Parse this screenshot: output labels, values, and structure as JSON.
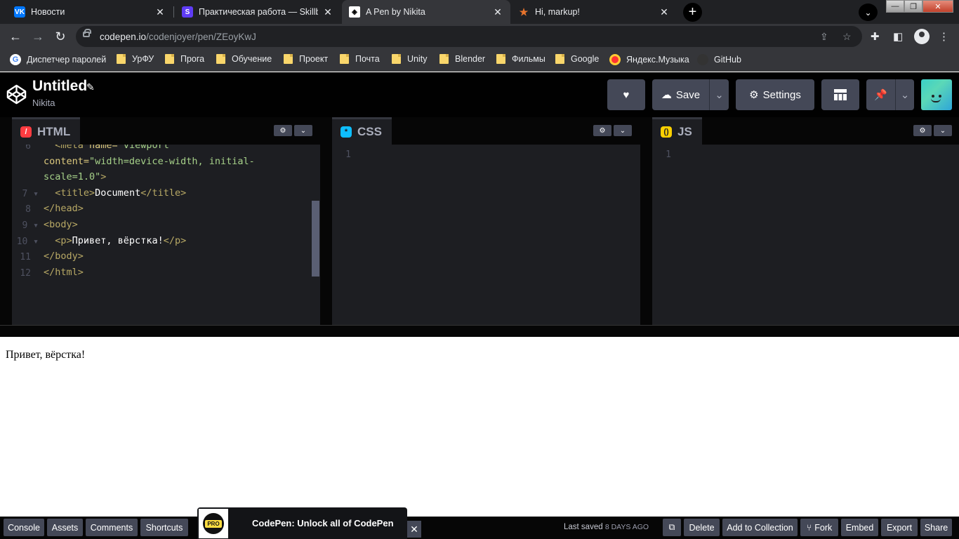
{
  "browser": {
    "tabs": [
      {
        "title": "Новости",
        "favicon": "vk-icon",
        "color": "#0077ff",
        "glyph": "VK"
      },
      {
        "title": "Практическая работа — Skillbox",
        "favicon": "skillbox-icon",
        "color": "#5f3cf5",
        "glyph": "S"
      },
      {
        "title": "A Pen by Nikita",
        "favicon": "codepen-icon",
        "color": "#ffffff",
        "glyph": "◈"
      },
      {
        "title": "Hi, markup!",
        "favicon": "star-icon",
        "color": "#202124",
        "glyph": "★"
      }
    ],
    "active_tab_index": 2,
    "url_host": "codepen.io",
    "url_path": "/codenjoyer/pen/ZEoyKwJ",
    "bookmarks": [
      {
        "label": "Диспетчер паролей",
        "icon": "google-icon"
      },
      {
        "label": "УрФУ",
        "icon": "folder-icon"
      },
      {
        "label": "Прога",
        "icon": "folder-icon"
      },
      {
        "label": "Обучение",
        "icon": "folder-icon"
      },
      {
        "label": "Проект",
        "icon": "folder-icon"
      },
      {
        "label": "Почта",
        "icon": "folder-icon"
      },
      {
        "label": "Unity",
        "icon": "folder-icon"
      },
      {
        "label": "Blender",
        "icon": "folder-icon"
      },
      {
        "label": "Фильмы",
        "icon": "folder-icon"
      },
      {
        "label": "Google",
        "icon": "folder-icon"
      },
      {
        "label": "Яндекс.Музыка",
        "icon": "yandex-music-icon"
      },
      {
        "label": "GitHub",
        "icon": "github-icon"
      }
    ]
  },
  "header": {
    "title": "Untitled",
    "author": "Nikita",
    "save_label": "Save",
    "settings_label": "Settings"
  },
  "editors": {
    "html": {
      "label": "HTML",
      "color": "#ff3c41",
      "glyph": "/",
      "lines": [
        {
          "num": "6",
          "html": "  <span class='tag'>&lt;meta</span> <span class='attr'>name=</span><span class='str'>\"viewport\"</span>",
          "fold": false
        },
        {
          "num": "",
          "html": "<span class='attr'>content=</span><span class='str'>\"width=device-width, initial-</span>",
          "fold": false
        },
        {
          "num": "",
          "html": "<span class='str'>scale=1.0\"</span><span class='tag'>&gt;</span>",
          "fold": false
        },
        {
          "num": "7",
          "html": "  <span class='tag'>&lt;title&gt;</span>Document<span class='tag'>&lt;/title&gt;</span>",
          "fold": true
        },
        {
          "num": "8",
          "html": "<span class='tag'>&lt;/head&gt;</span>",
          "fold": false
        },
        {
          "num": "9",
          "html": "<span class='tag'>&lt;body&gt;</span>",
          "fold": true
        },
        {
          "num": "10",
          "html": "  <span class='tag'>&lt;p&gt;</span>Привет, вёрстка!<span class='tag'>&lt;/p&gt;</span>",
          "fold": true
        },
        {
          "num": "11",
          "html": "<span class='tag'>&lt;/body&gt;</span>",
          "fold": false
        },
        {
          "num": "12",
          "html": "<span class='tag'>&lt;/html&gt;</span>",
          "fold": false
        }
      ]
    },
    "css": {
      "label": "CSS",
      "color": "#0ebeff",
      "glyph": "*",
      "line_num": "1"
    },
    "js": {
      "label": "JS",
      "color": "#fcd000",
      "glyph": "()",
      "line_num": "1"
    }
  },
  "preview": {
    "text": "Привет, вёрстка!"
  },
  "footer": {
    "left_buttons": [
      "Console",
      "Assets",
      "Comments",
      "Shortcuts"
    ],
    "promo_badge": "PRO",
    "promo_text": "CodePen: Unlock all of CodePen",
    "last_saved_label": "Last saved",
    "last_saved_ago": "8 DAYS AGO",
    "right_buttons": [
      "Delete",
      "Add to Collection",
      "Fork",
      "Embed",
      "Export",
      "Share"
    ]
  }
}
